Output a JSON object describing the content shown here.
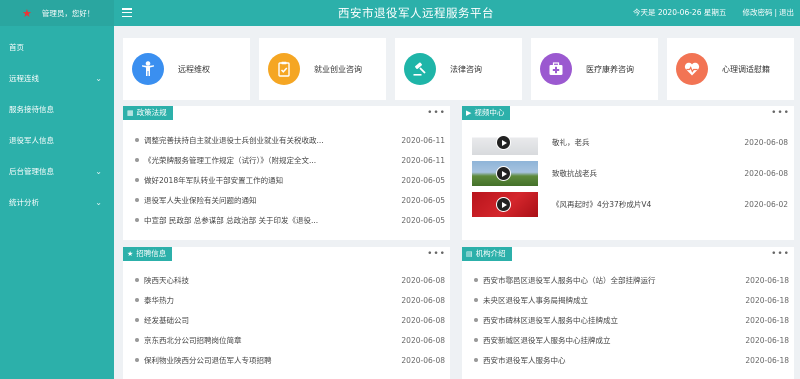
{
  "sidebar": {
    "greeting": "管理员，您好！",
    "items": [
      {
        "label": "首页",
        "has_children": false
      },
      {
        "label": "远程连线",
        "has_children": true
      },
      {
        "label": "服务接待信息",
        "has_children": false
      },
      {
        "label": "退役军人信息",
        "has_children": false
      },
      {
        "label": "后台管理信息",
        "has_children": true
      },
      {
        "label": "统计分析",
        "has_children": true
      }
    ]
  },
  "header": {
    "title": "西安市退役军人远程服务平台",
    "date": "今天是 2020-06-26 星期五",
    "change_password": "修改密码",
    "separator": "|",
    "logout": "退出"
  },
  "services": [
    {
      "label": "远程维权",
      "icon": "person-icon",
      "color": "#3a8ff0"
    },
    {
      "label": "就业创业咨询",
      "icon": "clipboard-icon",
      "color": "#f5a623"
    },
    {
      "label": "法律咨询",
      "icon": "gavel-icon",
      "color": "#1fb5a8"
    },
    {
      "label": "医疗康养咨询",
      "icon": "medical-kit-icon",
      "color": "#9b59d0"
    },
    {
      "label": "心理调适慰籍",
      "icon": "heart-pulse-icon",
      "color": "#f27454"
    }
  ],
  "policy": {
    "title": "政策法规",
    "icon": "grid-icon",
    "items": [
      {
        "text": "调整完善扶持自主就业退役士兵创业就业有关税收政...",
        "date": "2020-06-11"
      },
      {
        "text": "《光荣牌服务管理工作规定（试行）》（附规定全文...",
        "date": "2020-06-11"
      },
      {
        "text": "做好2018年军队转业干部安置工作的通知",
        "date": "2020-06-05"
      },
      {
        "text": "退役军人失业保险有关问题的通知",
        "date": "2020-06-05"
      },
      {
        "text": "中宣部 民政部 总参谋部 总政治部 关于印发《退役...",
        "date": "2020-06-05"
      }
    ]
  },
  "video": {
    "title": "视频中心",
    "icon": "video-icon",
    "items": [
      {
        "text": "敬礼，老兵",
        "date": "2020-06-08"
      },
      {
        "text": "致敬抗战老兵",
        "date": "2020-06-08"
      },
      {
        "text": "《风再起时》4分37秒成片V4",
        "date": "2020-06-02"
      }
    ]
  },
  "jobs": {
    "title": "招聘信息",
    "icon": "star-icon",
    "items": [
      {
        "text": "陕西天心科技",
        "date": "2020-06-08"
      },
      {
        "text": "泰华热力",
        "date": "2020-06-08"
      },
      {
        "text": "经发基础公司",
        "date": "2020-06-08"
      },
      {
        "text": "京东西北分公司招聘岗位简章",
        "date": "2020-06-08"
      },
      {
        "text": "保利物业陕西分公司退伍军人专项招聘",
        "date": "2020-06-08"
      }
    ]
  },
  "org": {
    "title": "机构介绍",
    "icon": "document-icon",
    "items": [
      {
        "text": "西安市鄠邑区退役军人服务中心（站）全部挂牌运行",
        "date": "2020-06-18"
      },
      {
        "text": "未央区退役军人事务局揭牌成立",
        "date": "2020-06-18"
      },
      {
        "text": "西安市碑林区退役军人服务中心挂牌成立",
        "date": "2020-06-18"
      },
      {
        "text": "西安新城区退役军人服务中心挂牌成立",
        "date": "2020-06-18"
      },
      {
        "text": "西安市退役军人服务中心",
        "date": "2020-06-18"
      }
    ]
  },
  "more_label": "•••"
}
